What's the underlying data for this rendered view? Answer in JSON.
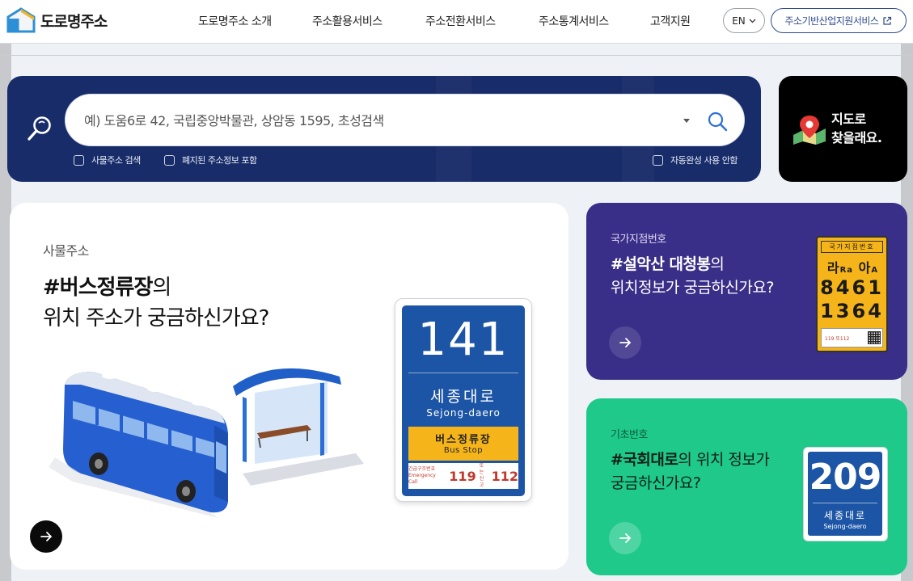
{
  "header": {
    "logo_text": "도로명주소",
    "nav": [
      {
        "label": "도로명주소 소개"
      },
      {
        "label": "주소활용서비스"
      },
      {
        "label": "주소전환서비스"
      },
      {
        "label": "주소통계서비스"
      },
      {
        "label": "고객지원"
      }
    ],
    "lang_label": "EN",
    "biz_label": "주소기반산업지원서비스"
  },
  "search": {
    "placeholder": "예) 도움6로 42, 국립중앙박물관, 상암동 1595, 초성검색",
    "value": "",
    "checks": {
      "building": "사물주소 검색",
      "closed": "폐지된 주소정보 포함",
      "autocomplete": "자동완성 사용 안함"
    }
  },
  "map": {
    "line1": "지도로",
    "line2": "찾을래요."
  },
  "main_card": {
    "tag": "사물주소",
    "title_highlight": "#버스정류장",
    "title_suffix": "의",
    "title_line2": "위치 주소가 궁금하신가요?",
    "sign": {
      "number": "141",
      "name_ko": "세종대로",
      "name_en": "Sejong-daero",
      "label_ko": "버스정류장",
      "label_en": "Bus Stop",
      "emer_text": "긴급구조번호",
      "emer_text_en": "Emergency Call",
      "emer_119": "119",
      "emer_small2": "또는",
      "emer_small3": "신고",
      "emer_112": "112"
    }
  },
  "national_card": {
    "tag": "국가지점번호",
    "title_highlight": "#설악산 대청봉",
    "title_suffix": "의",
    "title_line2": "위치정보가 궁금하신가요?",
    "sign": {
      "head": "국가지점번호",
      "row1_a": "라",
      "row1_a_small": "Ra",
      "row1_b": "아",
      "row1_b_small": "A",
      "line1": "8461",
      "line2": "1364",
      "foot": "119 또112"
    }
  },
  "base_card": {
    "tag": "기초번호",
    "title_highlight": "#국회대로",
    "title_suffix": "의 위치 정보가",
    "title_line2": "궁금하신가요?",
    "sign": {
      "number": "209",
      "name_ko": "세종대로",
      "name_en": "Sejong-daero"
    }
  },
  "colors": {
    "search_panel": "#182c6a",
    "purple_card": "#3a2f88",
    "green_card": "#1ec98a",
    "sign_blue": "#1c55a5",
    "sign_yellow": "#f5b51a"
  }
}
